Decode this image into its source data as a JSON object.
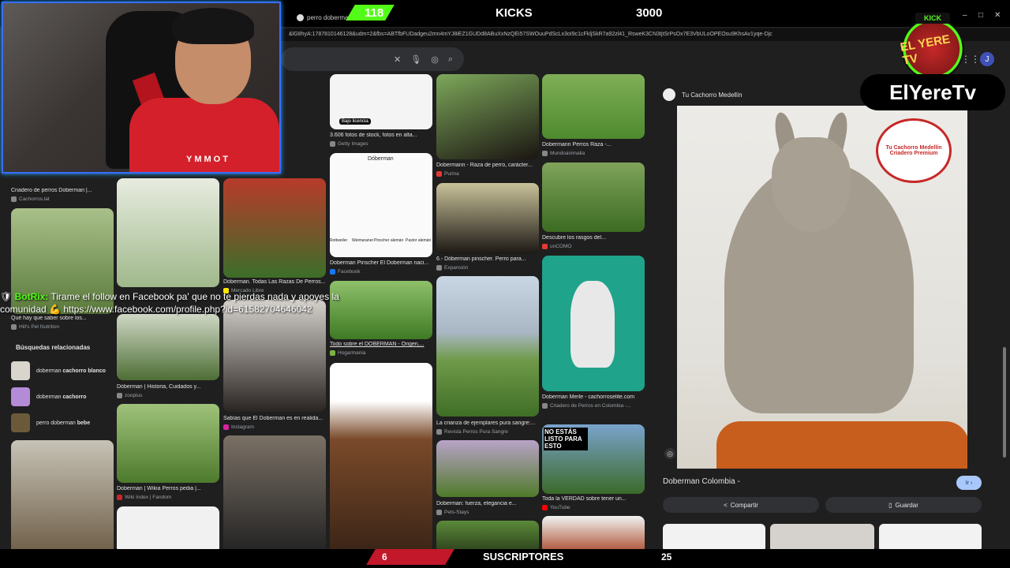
{
  "browser": {
    "tab_title": "perro doberman -",
    "url": "&lG8hyA:1787810146128&udm=2&fbs=ABTfbFUDadgeu2mn4mYJ8iEZ1GUDd8ABuXxNzQEi57SWOuuPdScLx3oI9c1cFkljSkR7a92zl41_RsweK3CN3tjtSrPsOx7E3VbULoOPEOsu9KhsAv1yqe-Djc",
    "avatar_letter": "J",
    "window_controls": [
      "–",
      "□",
      "✕"
    ]
  },
  "stream": {
    "kicks_left_value": "118",
    "kicks_label": "KICKS",
    "kicks_count": "3000",
    "subs_left_value": "6",
    "subs_label": "SUSCRIPTORES",
    "subs_count": "25",
    "brand_name": "ElYereTv",
    "brand_logo_text": "EL YERE TV",
    "kick_badge": "KICK",
    "webcam_shirt_text": "YMMOT"
  },
  "chat": {
    "user": "BotRix:",
    "message": "Tirame el follow en Facebook pa' que no te pierdas nada y apoyes la comunidad 💪 https://www.facebook.com/profile.php?id=61582704646042"
  },
  "left_column": {
    "captions": [
      {
        "title": "Criadero de perros Doberman |...",
        "source": "Cachorros.lat"
      },
      {
        "title": "Qué hay que saber sobre los...",
        "source": "Hill's Pet Nutrition"
      },
      {
        "title": "Dóberman | Historia, Cuidados y...",
        "source": "zooplus"
      },
      {
        "title": "Doberman | Wikia Perros pedia |...",
        "source": "Wiki Index | Fandom"
      },
      {
        "title": "Dóberman. Todas Las Razas De Perros...",
        "source": "Mercado Libre"
      },
      {
        "title": "Sabías que El Doberman es en realida...",
        "source": "Instagram"
      }
    ],
    "related_title": "Búsquedas relacionadas",
    "related": [
      {
        "prefix": "doberman ",
        "bold": "cachorro blanco"
      },
      {
        "prefix": "doberman ",
        "bold": "cachorro"
      },
      {
        "prefix": "perro doberman ",
        "bold": "bebe"
      }
    ]
  },
  "mid_column": {
    "badge": "Bajo licencia",
    "captions": [
      {
        "title": "3.606 fotos de stock, fotos en alta...",
        "source": "Getty Images"
      },
      {
        "title": "Doberman Pinscher El Doberman naci...",
        "source": "Facebook"
      },
      {
        "title": "Todo sobre el DÓBERMAN - Origen,...",
        "source": "Hogarmania"
      },
      {
        "title": "Dobermann - Raza de perro, carácter...",
        "source": "Purina"
      },
      {
        "title": "6.- Dóberman pinscher. Perro para...",
        "source": "Expansión"
      },
      {
        "title": "La crianza de ejemplares pura sangre:...",
        "source": "Revista Perros Pura Sangre"
      },
      {
        "title": "Doberman: fuerza, elegancia e...",
        "source": "Pets-Stays"
      }
    ],
    "chart_labels": [
      "Dóberman",
      "Rottweiler",
      "Weimaraner",
      "Pinscher alemán",
      "Pastor alemán"
    ]
  },
  "right_column": {
    "captions": [
      {
        "title": "Dobermann Perros Raza -...",
        "source": "Mundoanimalia"
      },
      {
        "title": "Descubre los rasgos del...",
        "source": "unCOMO"
      },
      {
        "title": "Doberman Merle - cachorroselite.com",
        "source": "Criadero de Perros en Colombia -..."
      },
      {
        "title": "Toda la VERDAD sobre tener un...",
        "source": "YouTube"
      }
    ],
    "thumb_text": "NO ESTÁS LISTO PARA ESTO"
  },
  "panel": {
    "source": "Tu Cachorro Medellín",
    "logo_text": "Tu Cachorro Medellín Criadero Premium",
    "title": "Doberman Colombia -",
    "visit_button": "Ir",
    "share_button": "Compartir",
    "save_button": "Guardar"
  }
}
